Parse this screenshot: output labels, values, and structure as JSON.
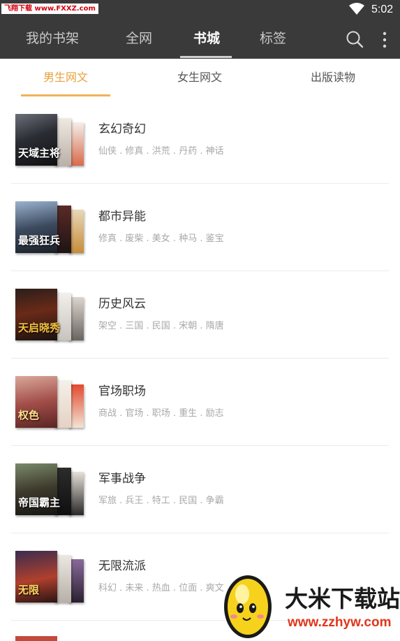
{
  "status_bar": {
    "watermark": "飞翔下载 www.FXXZ.com",
    "time": "5:02"
  },
  "app_bar": {
    "tabs": [
      {
        "label": "我的书架",
        "active": false
      },
      {
        "label": "全网",
        "active": false
      },
      {
        "label": "书城",
        "active": true
      },
      {
        "label": "标签",
        "active": false
      }
    ],
    "icons": [
      "search-icon",
      "more-vert-icon"
    ]
  },
  "sub_tabs": [
    {
      "label": "男生网文",
      "active": true
    },
    {
      "label": "女生网文",
      "active": false
    },
    {
      "label": "出版读物",
      "active": false
    }
  ],
  "colors": {
    "app_bar_bg": "#3a3a3a",
    "accent": "#e8a23c",
    "text_primary": "#333333",
    "text_secondary": "#a8a8a8"
  },
  "categories": [
    {
      "title": "玄幻奇幻",
      "tags": "仙侠 . 修真 . 洪荒 . 丹药 . 神话",
      "cover_text": "天域主将"
    },
    {
      "title": "都市异能",
      "tags": "修真 . 废柴 . 美女 . 种马 . 鉴宝",
      "cover_text": "最强狂兵"
    },
    {
      "title": "历史风云",
      "tags": "架空 . 三国 . 民国 . 宋朝 . 隋唐",
      "cover_text": "天启晓秀"
    },
    {
      "title": "官场职场",
      "tags": "商战 . 官场 . 职场 . 重生 . 励志",
      "cover_text": "权色"
    },
    {
      "title": "军事战争",
      "tags": "军旅 . 兵王 . 特工 . 民国 . 争霸",
      "cover_text": "帝国霸主"
    },
    {
      "title": "无限流派",
      "tags": "科幻 . 未来 . 热血 . 位面 . 爽文",
      "cover_text": "无限"
    }
  ],
  "watermark_bottom": {
    "name": "大米下载站",
    "url": "www.zzhyw.com"
  }
}
